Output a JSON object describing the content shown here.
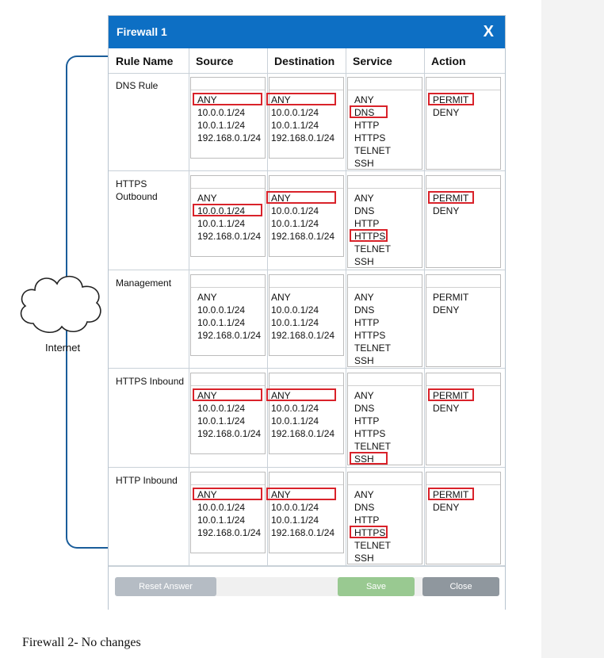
{
  "dialog": {
    "title": "Firewall 1",
    "close_label": "X",
    "columns": [
      "Rule Name",
      "Source",
      "Destination",
      "Service",
      "Action"
    ]
  },
  "sidebar": {
    "internet_label": "Internet"
  },
  "rules": [
    {
      "name": "DNS Rule",
      "source": [
        "ANY",
        "10.0.0.1/24",
        "10.0.1.1/24",
        "192.168.0.1/24"
      ],
      "destination": [
        "ANY",
        "10.0.0.1/24",
        "10.0.1.1/24",
        "192.168.0.1/24"
      ],
      "service": [
        "ANY",
        "DNS",
        "HTTP",
        "HTTPS",
        "TELNET",
        "SSH"
      ],
      "action": [
        "PERMIT",
        "DENY"
      ],
      "selected": {
        "source": "ANY",
        "destination": "ANY",
        "service": "DNS",
        "action": "PERMIT"
      }
    },
    {
      "name": "HTTPS Outbound",
      "source": [
        "ANY",
        "10.0.0.1/24",
        "10.0.1.1/24",
        "192.168.0.1/24"
      ],
      "destination": [
        "ANY",
        "10.0.0.1/24",
        "10.0.1.1/24",
        "192.168.0.1/24"
      ],
      "service": [
        "ANY",
        "DNS",
        "HTTP",
        "HTTPS",
        "TELNET",
        "SSH"
      ],
      "action": [
        "PERMIT",
        "DENY"
      ],
      "selected": {
        "source": "10.0.0.1/24",
        "destination": "ANY",
        "service": "HTTPS",
        "action": "PERMIT"
      }
    },
    {
      "name": "Management",
      "source": [
        "ANY",
        "10.0.0.1/24",
        "10.0.1.1/24",
        "192.168.0.1/24"
      ],
      "destination": [
        "ANY",
        "10.0.0.1/24",
        "10.0.1.1/24",
        "192.168.0.1/24"
      ],
      "service": [
        "ANY",
        "DNS",
        "HTTP",
        "HTTPS",
        "TELNET",
        "SSH"
      ],
      "action": [
        "PERMIT",
        "DENY"
      ],
      "selected": {}
    },
    {
      "name": "HTTPS Inbound",
      "source": [
        "ANY",
        "10.0.0.1/24",
        "10.0.1.1/24",
        "192.168.0.1/24"
      ],
      "destination": [
        "ANY",
        "10.0.0.1/24",
        "10.0.1.1/24",
        "192.168.0.1/24"
      ],
      "service": [
        "ANY",
        "DNS",
        "HTTP",
        "HTTPS",
        "TELNET",
        "SSH"
      ],
      "action": [
        "PERMIT",
        "DENY"
      ],
      "selected": {
        "source": "ANY",
        "destination": "ANY",
        "service": "SSH",
        "action": "PERMIT"
      }
    },
    {
      "name": "HTTP Inbound",
      "source": [
        "ANY",
        "10.0.0.1/24",
        "10.0.1.1/24",
        "192.168.0.1/24"
      ],
      "destination": [
        "ANY",
        "10.0.0.1/24",
        "10.0.1.1/24",
        "192.168.0.1/24"
      ],
      "service": [
        "ANY",
        "DNS",
        "HTTP",
        "HTTPS",
        "TELNET",
        "SSH"
      ],
      "action": [
        "PERMIT",
        "DENY"
      ],
      "selected": {
        "source": "ANY",
        "destination": "ANY",
        "service": "HTTPS",
        "action": "PERMIT"
      }
    }
  ],
  "footer": {
    "reset_label": "Reset Answer",
    "save_label": "Save",
    "close_label": "Close"
  },
  "caption": "Firewall 2- No changes",
  "colors": {
    "titlebar": "#0d6fc4",
    "selection": "#d9222a",
    "line": "#1a5d9a",
    "save": "#99c991"
  }
}
